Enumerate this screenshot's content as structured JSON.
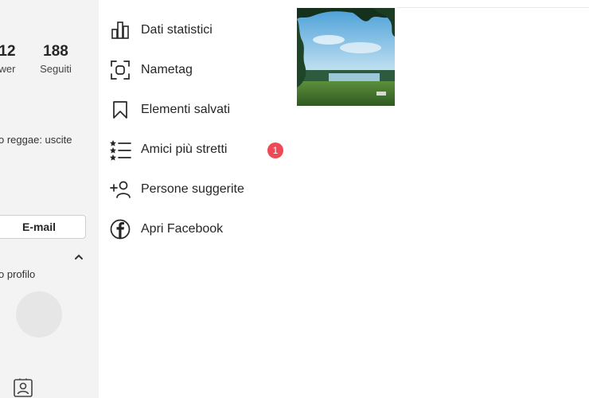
{
  "profile": {
    "stats": [
      {
        "value": "12",
        "label": "wer"
      },
      {
        "value": "188",
        "label": "Seguiti"
      }
    ],
    "bio": "o reggae: uscite",
    "email_button": "E-mail",
    "section_label": "o profilo"
  },
  "menu": {
    "items": [
      {
        "label": "Dati statistici",
        "icon": "bar-chart-icon"
      },
      {
        "label": "Nametag",
        "icon": "nametag-scan-icon"
      },
      {
        "label": "Elementi salvati",
        "icon": "bookmark-icon"
      },
      {
        "label": "Amici più stretti",
        "icon": "close-friends-list-icon",
        "badge": "1"
      },
      {
        "label": "Persone suggerite",
        "icon": "add-person-icon"
      },
      {
        "label": "Apri Facebook",
        "icon": "facebook-icon"
      }
    ]
  },
  "colors": {
    "badge": "#ed4956",
    "left_panel_bg": "#f3f3f3",
    "text": "#262626"
  }
}
